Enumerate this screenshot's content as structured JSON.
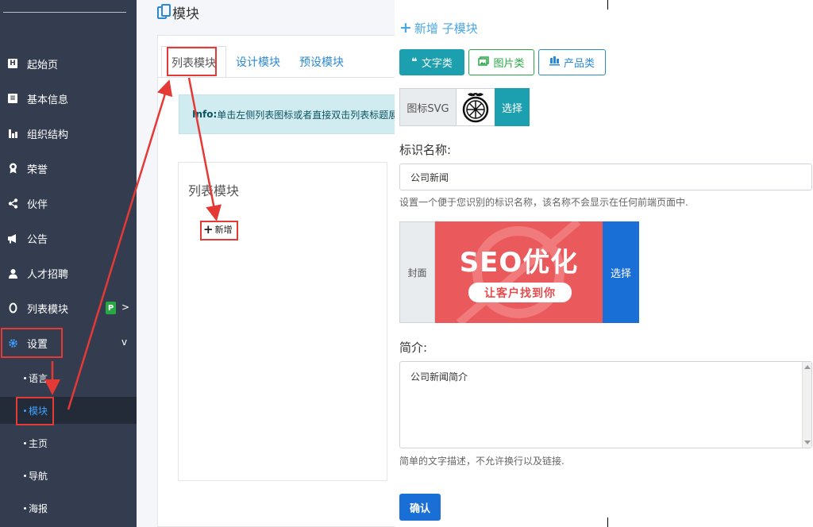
{
  "sidebar": {
    "items": [
      {
        "label": "起始页",
        "icon": "h-box-icon"
      },
      {
        "label": "基本信息",
        "icon": "id-card-icon"
      },
      {
        "label": "组织结构",
        "icon": "org-chart-icon"
      },
      {
        "label": "荣誉",
        "icon": "award-icon"
      },
      {
        "label": "伙伴",
        "icon": "share-icon"
      },
      {
        "label": "公告",
        "icon": "megaphone-icon"
      },
      {
        "label": "人才招聘",
        "icon": "user-icon"
      },
      {
        "label": "列表模块",
        "icon": "circle-icon",
        "badge": "P"
      },
      {
        "label": "设置",
        "icon": "gear-icon",
        "chevron": "v"
      }
    ],
    "subitems": [
      {
        "label": "语言"
      },
      {
        "label": "模块"
      },
      {
        "label": "主页"
      },
      {
        "label": "导航"
      },
      {
        "label": "海报"
      }
    ]
  },
  "page": {
    "title": "模块",
    "tabs": [
      {
        "label": "列表模块"
      },
      {
        "label": "设计模块"
      },
      {
        "label": "预设模块"
      }
    ],
    "info_prefix": "Info:",
    "info_text": "单击左侧列表图标或者直接双击列表标题展",
    "card_title": "列表模块",
    "add_label": "新增"
  },
  "form": {
    "add_sub_label": "新增 子模块",
    "types": [
      {
        "label": "文字类",
        "icon": "quote-icon"
      },
      {
        "label": "图片类",
        "icon": "images-icon"
      },
      {
        "label": "产品类",
        "icon": "product-icon"
      }
    ],
    "icon_svg_label": "图标SVG",
    "choose_label": "选择",
    "name_label": "标识名称:",
    "name_value": "公司新闻",
    "name_help": "设置一个便于您识别的标识名称，该名称不会显示在任何前端页面中.",
    "cover_label": "封面",
    "cover_choose_label": "选择",
    "cover_image_text": "SEO优化",
    "cover_image_subtext": "让客户找到你",
    "intro_label": "简介:",
    "intro_value": "公司新闻简介",
    "intro_help": "简单的文字描述，不允许换行以及链接.",
    "confirm_label": "确认"
  },
  "colors": {
    "sidebar_bg": "#343d4f",
    "accent_blue": "#2b8ad6",
    "info_teal": "#1ca0b0",
    "success_green": "#28a745",
    "annotation_red": "#e53935"
  }
}
